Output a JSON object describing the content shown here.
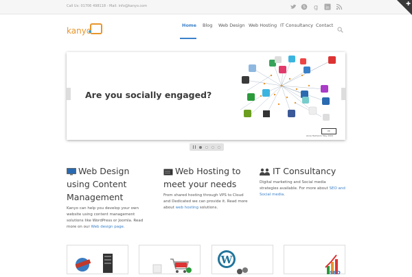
{
  "topbar": {
    "contact_text": "Call Us: 01706 498118 - Mail: info@kanyo.com",
    "social_icons": [
      "twitter-icon",
      "skype-icon",
      "google-plus-icon",
      "linkedin-icon",
      "rss-icon"
    ]
  },
  "logo": {
    "text": "kanyo"
  },
  "nav": {
    "items": [
      {
        "label": "Home",
        "active": true
      },
      {
        "label": "Blog",
        "active": false
      },
      {
        "label": "Web Design",
        "active": false
      },
      {
        "label": "Web Hosting",
        "active": false
      },
      {
        "label": "IT Consultancy",
        "active": false
      },
      {
        "label": "Contact",
        "active": false
      }
    ],
    "search_icon": "search-icon",
    "accent": "#3a80c8"
  },
  "slider": {
    "headline": "Are you socially engaged?",
    "credit": "Anne Helmond, May 2009",
    "cc_label": "cc",
    "pager": {
      "slides": 4,
      "current": 1
    }
  },
  "services": [
    {
      "icon": "monitor-icon",
      "title": "Web Design using Content Management",
      "text_before": "Kanyo can help you develop your own website using content management solutions like WordPress or Joomla. Read more on our ",
      "link": "Web design page",
      "text_after": "."
    },
    {
      "icon": "server-icon",
      "title": "Web Hosting to meet your needs",
      "text_before": "From shared hosting through VPS to Cloud and Dedicated we can provide it. Read more about ",
      "link": "web hosting",
      "text_after": " solutions."
    },
    {
      "icon": "users-icon",
      "title": "IT Consultancy",
      "text_before": "Digital marketing and Social media strategies available. For more about ",
      "link": "SEO and Social media",
      "text_after": "."
    }
  ],
  "boxes": [
    {
      "icon": "web-servers-icon"
    },
    {
      "icon": "shopping-cart-icon"
    },
    {
      "icon": "wordpress-icon"
    },
    {
      "icon": "seo-chart-icon"
    }
  ]
}
